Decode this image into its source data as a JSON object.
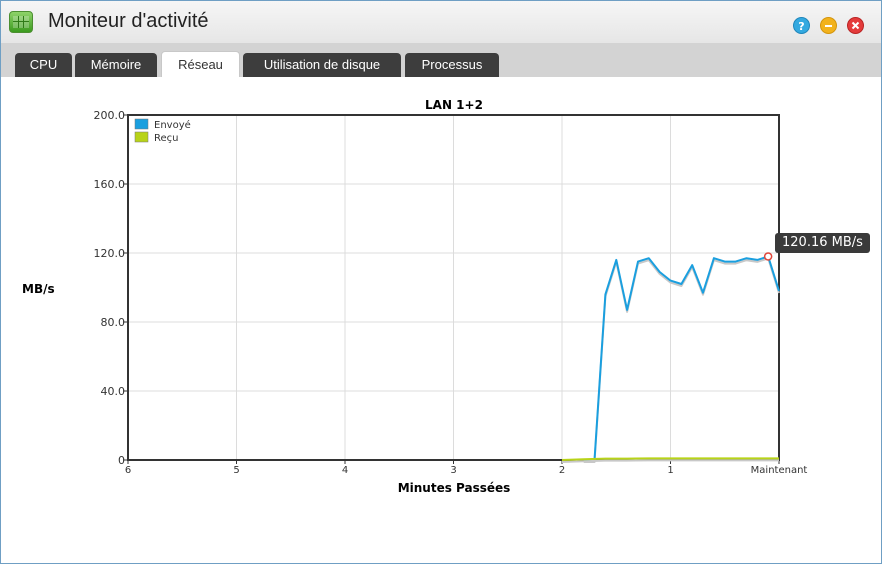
{
  "window": {
    "title": "Moniteur d'activité",
    "icon": "activity-monitor-icon",
    "controls": {
      "help": "?",
      "minimize": "–",
      "close": "✕"
    }
  },
  "tabs": [
    {
      "label": "CPU",
      "active": false
    },
    {
      "label": "Mémoire",
      "active": false
    },
    {
      "label": "Réseau",
      "active": true
    },
    {
      "label": "Utilisation de disque",
      "active": false
    },
    {
      "label": "Processus",
      "active": false
    }
  ],
  "chart_data": {
    "type": "line",
    "title": "LAN 1+2",
    "xlabel": "Minutes Passées",
    "ylabel": "MB/s",
    "xlim": [
      6,
      0
    ],
    "ylim": [
      0,
      200
    ],
    "x_ticks": [
      "6",
      "5",
      "4",
      "3",
      "2",
      "1",
      "Maintenant"
    ],
    "y_ticks": [
      "0",
      "40.0",
      "80.0",
      "120.0",
      "160.0",
      "200.0"
    ],
    "grid": true,
    "legend_position": "top-left",
    "tooltip": "120.16 MB/s",
    "series": [
      {
        "name": "Envoyé",
        "color": "#1a9fdf",
        "x": [
          1.8,
          1.7,
          1.6,
          1.5,
          1.4,
          1.3,
          1.2,
          1.1,
          1.0,
          0.9,
          0.8,
          0.7,
          0.6,
          0.5,
          0.4,
          0.3,
          0.2,
          0.1,
          0
        ],
        "y": [
          0,
          0,
          96,
          116,
          87,
          115,
          117,
          109,
          104,
          102,
          113,
          97,
          117,
          115,
          115,
          117,
          116,
          118,
          98
        ]
      },
      {
        "name": "Reçu",
        "color": "#b8d318",
        "x": [
          2.0,
          1.8,
          1.6,
          1.4,
          1.2,
          1.0,
          0.8,
          0.6,
          0.4,
          0.2,
          0
        ],
        "y": [
          0,
          0.4,
          0.8,
          0.8,
          0.9,
          0.9,
          0.9,
          0.9,
          0.9,
          0.9,
          0.9
        ]
      }
    ],
    "highlight_point": {
      "series": "Envoyé",
      "x": 0.1,
      "y": 118
    }
  }
}
